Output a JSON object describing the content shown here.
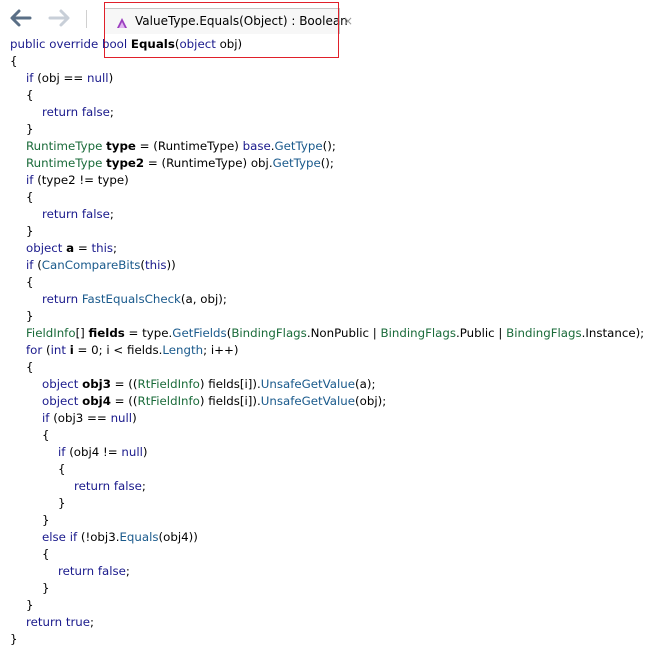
{
  "toolbar": {
    "back_icon": "back-arrow-icon",
    "forward_icon": "forward-arrow-icon"
  },
  "tab": {
    "icon": "method-icon",
    "label": "ValueType.Equals(Object) : Boolean",
    "close": "×"
  },
  "code": {
    "lines": [
      {
        "indent": 0,
        "tokens": [
          [
            "public override ",
            "kw"
          ],
          [
            "bool ",
            "kw"
          ],
          [
            "Equals",
            "b"
          ],
          [
            "(",
            ""
          ],
          [
            "object ",
            "kw"
          ],
          [
            "obj)",
            ""
          ]
        ]
      },
      {
        "indent": 0,
        "tokens": [
          [
            "{",
            ""
          ]
        ]
      },
      {
        "indent": 1,
        "tokens": [
          [
            "if ",
            "kw"
          ],
          [
            "(obj == ",
            ""
          ],
          [
            "null",
            "kw"
          ],
          [
            ")",
            ""
          ]
        ]
      },
      {
        "indent": 1,
        "tokens": [
          [
            "{",
            ""
          ]
        ]
      },
      {
        "indent": 2,
        "tokens": [
          [
            "return ",
            "kw"
          ],
          [
            "false",
            "kw"
          ],
          [
            ";",
            ""
          ]
        ]
      },
      {
        "indent": 1,
        "tokens": [
          [
            "}",
            ""
          ]
        ]
      },
      {
        "indent": 1,
        "tokens": [
          [
            "RuntimeType ",
            "ty"
          ],
          [
            "type",
            "b"
          ],
          [
            " = (",
            ""
          ],
          [
            "RuntimeType",
            ""
          ],
          [
            ") ",
            ""
          ],
          [
            "base",
            "kw"
          ],
          [
            ".",
            ""
          ],
          [
            "GetType",
            "mt"
          ],
          [
            "();",
            ""
          ]
        ]
      },
      {
        "indent": 1,
        "tokens": [
          [
            "RuntimeType ",
            "ty"
          ],
          [
            "type2",
            "b"
          ],
          [
            " = (",
            ""
          ],
          [
            "RuntimeType",
            ""
          ],
          [
            ") obj.",
            ""
          ],
          [
            "GetType",
            "mt"
          ],
          [
            "();",
            ""
          ]
        ]
      },
      {
        "indent": 1,
        "tokens": [
          [
            "if ",
            "kw"
          ],
          [
            "(type2 != type)",
            ""
          ]
        ]
      },
      {
        "indent": 1,
        "tokens": [
          [
            "{",
            ""
          ]
        ]
      },
      {
        "indent": 2,
        "tokens": [
          [
            "return ",
            "kw"
          ],
          [
            "false",
            "kw"
          ],
          [
            ";",
            ""
          ]
        ]
      },
      {
        "indent": 1,
        "tokens": [
          [
            "}",
            ""
          ]
        ]
      },
      {
        "indent": 1,
        "tokens": [
          [
            "object ",
            "kw"
          ],
          [
            "a",
            "b"
          ],
          [
            " = ",
            ""
          ],
          [
            "this",
            "kw"
          ],
          [
            ";",
            ""
          ]
        ]
      },
      {
        "indent": 1,
        "tokens": [
          [
            "if ",
            "kw"
          ],
          [
            "(",
            ""
          ],
          [
            "CanCompareBits",
            "mt"
          ],
          [
            "(",
            ""
          ],
          [
            "this",
            "kw"
          ],
          [
            "))",
            ""
          ]
        ]
      },
      {
        "indent": 1,
        "tokens": [
          [
            "{",
            ""
          ]
        ]
      },
      {
        "indent": 2,
        "tokens": [
          [
            "return ",
            "kw"
          ],
          [
            "FastEqualsCheck",
            "mt"
          ],
          [
            "(a, obj);",
            ""
          ]
        ]
      },
      {
        "indent": 1,
        "tokens": [
          [
            "}",
            ""
          ]
        ]
      },
      {
        "indent": 1,
        "tokens": [
          [
            "FieldInfo",
            "ty"
          ],
          [
            "[] ",
            ""
          ],
          [
            "fields",
            "b"
          ],
          [
            " = type.",
            ""
          ],
          [
            "GetFields",
            "mt"
          ],
          [
            "(",
            ""
          ],
          [
            "BindingFlags",
            "ty"
          ],
          [
            ".NonPublic | ",
            ""
          ],
          [
            "BindingFlags",
            "ty"
          ],
          [
            ".Public | ",
            ""
          ],
          [
            "BindingFlags",
            "ty"
          ],
          [
            ".Instance);",
            ""
          ]
        ]
      },
      {
        "indent": 1,
        "tokens": [
          [
            "for ",
            "kw"
          ],
          [
            "(",
            ""
          ],
          [
            "int ",
            "kw"
          ],
          [
            "i",
            "b"
          ],
          [
            " = 0; i < fields.",
            ""
          ],
          [
            "Length",
            "mt"
          ],
          [
            "; i++)",
            ""
          ]
        ]
      },
      {
        "indent": 1,
        "tokens": [
          [
            "{",
            ""
          ]
        ]
      },
      {
        "indent": 2,
        "tokens": [
          [
            "object ",
            "kw"
          ],
          [
            "obj3",
            "b"
          ],
          [
            " = ((",
            ""
          ],
          [
            "RtFieldInfo",
            "ty"
          ],
          [
            ") fields[i]).",
            ""
          ],
          [
            "UnsafeGetValue",
            "mt"
          ],
          [
            "(a);",
            ""
          ]
        ]
      },
      {
        "indent": 2,
        "tokens": [
          [
            "object ",
            "kw"
          ],
          [
            "obj4",
            "b"
          ],
          [
            " = ((",
            ""
          ],
          [
            "RtFieldInfo",
            "ty"
          ],
          [
            ") fields[i]).",
            ""
          ],
          [
            "UnsafeGetValue",
            "mt"
          ],
          [
            "(obj);",
            ""
          ]
        ]
      },
      {
        "indent": 2,
        "tokens": [
          [
            "if ",
            "kw"
          ],
          [
            "(obj3 == ",
            ""
          ],
          [
            "null",
            "kw"
          ],
          [
            ")",
            ""
          ]
        ]
      },
      {
        "indent": 2,
        "tokens": [
          [
            "{",
            ""
          ]
        ]
      },
      {
        "indent": 3,
        "tokens": [
          [
            "if ",
            "kw"
          ],
          [
            "(obj4 != ",
            ""
          ],
          [
            "null",
            "kw"
          ],
          [
            ")",
            ""
          ]
        ]
      },
      {
        "indent": 3,
        "tokens": [
          [
            "{",
            ""
          ]
        ]
      },
      {
        "indent": 4,
        "tokens": [
          [
            "return ",
            "kw"
          ],
          [
            "false",
            "kw"
          ],
          [
            ";",
            ""
          ]
        ]
      },
      {
        "indent": 3,
        "tokens": [
          [
            "}",
            ""
          ]
        ]
      },
      {
        "indent": 2,
        "tokens": [
          [
            "}",
            ""
          ]
        ]
      },
      {
        "indent": 2,
        "tokens": [
          [
            "else if ",
            "kw"
          ],
          [
            "(!obj3.",
            ""
          ],
          [
            "Equals",
            "mt"
          ],
          [
            "(obj4))",
            ""
          ]
        ]
      },
      {
        "indent": 2,
        "tokens": [
          [
            "{",
            ""
          ]
        ]
      },
      {
        "indent": 3,
        "tokens": [
          [
            "return ",
            "kw"
          ],
          [
            "false",
            "kw"
          ],
          [
            ";",
            ""
          ]
        ]
      },
      {
        "indent": 2,
        "tokens": [
          [
            "}",
            ""
          ]
        ]
      },
      {
        "indent": 1,
        "tokens": [
          [
            "}",
            ""
          ]
        ]
      },
      {
        "indent": 1,
        "tokens": [
          [
            "return ",
            "kw"
          ],
          [
            "true",
            "kw"
          ],
          [
            ";",
            ""
          ]
        ]
      },
      {
        "indent": 0,
        "tokens": [
          [
            "}",
            ""
          ]
        ]
      }
    ]
  }
}
